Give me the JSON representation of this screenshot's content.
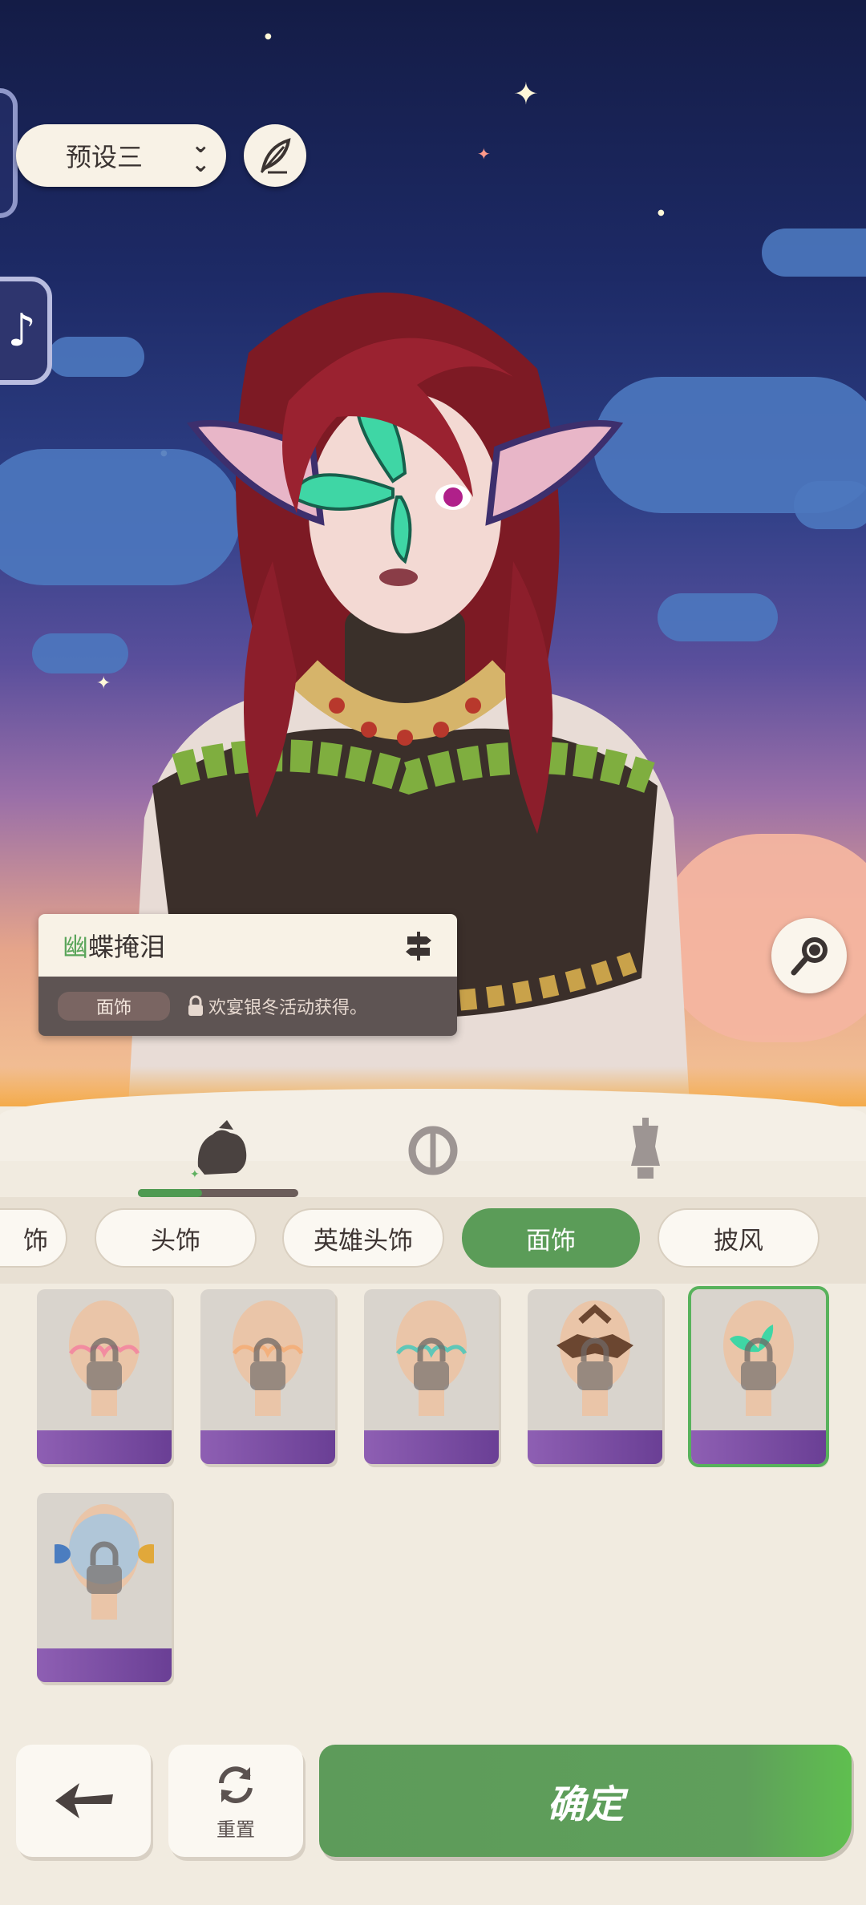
{
  "header": {
    "preset_label": "预设三"
  },
  "item_card": {
    "name_first_char": "幽",
    "name_rest": "蝶掩泪",
    "category_tag": "面饰",
    "source_text": "欢宴银冬活动获得。"
  },
  "category_tabs": [
    {
      "name": "outfit-tab",
      "icon": "outfit-icon",
      "active": true
    },
    {
      "name": "face-tab",
      "icon": "face-mask-icon",
      "active": false
    },
    {
      "name": "body-tab",
      "icon": "mannequin-icon",
      "active": false
    }
  ],
  "sub_tabs": [
    {
      "label": "饰"
    },
    {
      "label": "头饰"
    },
    {
      "label": "英雄头饰"
    },
    {
      "label": "面饰",
      "active": true
    },
    {
      "label": "披风"
    }
  ],
  "items": [
    {
      "type": "heart-glasses-pink",
      "locked": true,
      "selected": false
    },
    {
      "type": "heart-glasses-peach",
      "locked": true,
      "selected": false
    },
    {
      "type": "heart-glasses-teal",
      "locked": true,
      "selected": false
    },
    {
      "type": "bat-mask-brown",
      "locked": true,
      "selected": false
    },
    {
      "type": "butterfly-mask-green",
      "locked": true,
      "selected": true
    },
    {
      "type": "fish-mask-blue",
      "locked": true,
      "selected": false
    }
  ],
  "footer": {
    "reset_label": "重置",
    "confirm_label": "确定"
  },
  "colors": {
    "accent_green": "#5b9c58",
    "panel_bg": "#f1ebe0",
    "card_dark": "#5e5453"
  }
}
